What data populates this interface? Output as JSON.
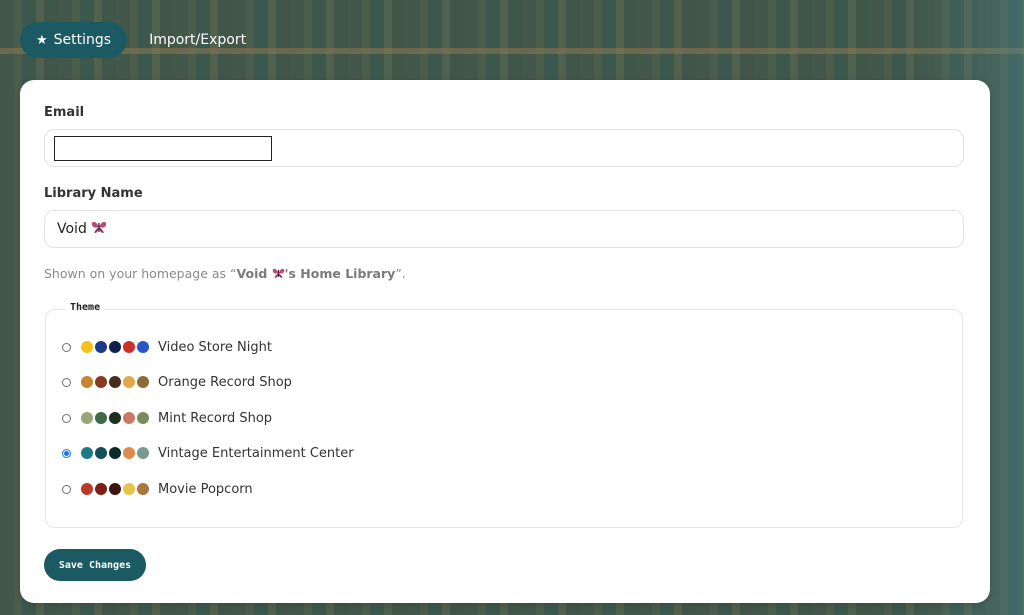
{
  "tabs": [
    {
      "label": "Settings",
      "icon": "star-icon",
      "active": true
    },
    {
      "label": "Import/Export",
      "active": false
    }
  ],
  "form": {
    "email_label": "Email",
    "email_value": "",
    "library_label": "Library Name",
    "library_value": "Void",
    "library_value_emoji": "butterfly-icon",
    "hint_prefix": "Shown on your homepage as “",
    "hint_bold_name": "Void",
    "hint_bold_suffix": "'s Home Library",
    "hint_suffix": "”."
  },
  "theme": {
    "legend": "Theme",
    "options": [
      {
        "name": "Video Store Night",
        "selected": false,
        "colors": [
          "#f2c21b",
          "#1c3a8c",
          "#0f1f4a",
          "#cf2f2b",
          "#2a55c9"
        ]
      },
      {
        "name": "Orange Record Shop",
        "selected": false,
        "colors": [
          "#c8842f",
          "#8a3a1e",
          "#4a2a1a",
          "#e0a84a",
          "#8c6a3a"
        ]
      },
      {
        "name": "Mint Record Shop",
        "selected": false,
        "colors": [
          "#9aa67a",
          "#3e6a48",
          "#1c3020",
          "#c97a64",
          "#7d8a5e"
        ]
      },
      {
        "name": "Vintage Entertainment Center",
        "selected": true,
        "colors": [
          "#1f7a86",
          "#135056",
          "#0c2a2a",
          "#e08b4e",
          "#7a9a8e"
        ]
      },
      {
        "name": "Movie Popcorn",
        "selected": false,
        "colors": [
          "#b83a2a",
          "#7a2016",
          "#3e1410",
          "#e8c24a",
          "#a8783e"
        ]
      }
    ]
  },
  "save_label": "Save Changes",
  "colors": {
    "accent": "#1b5a63",
    "radio_checked": "#1a73e8"
  }
}
